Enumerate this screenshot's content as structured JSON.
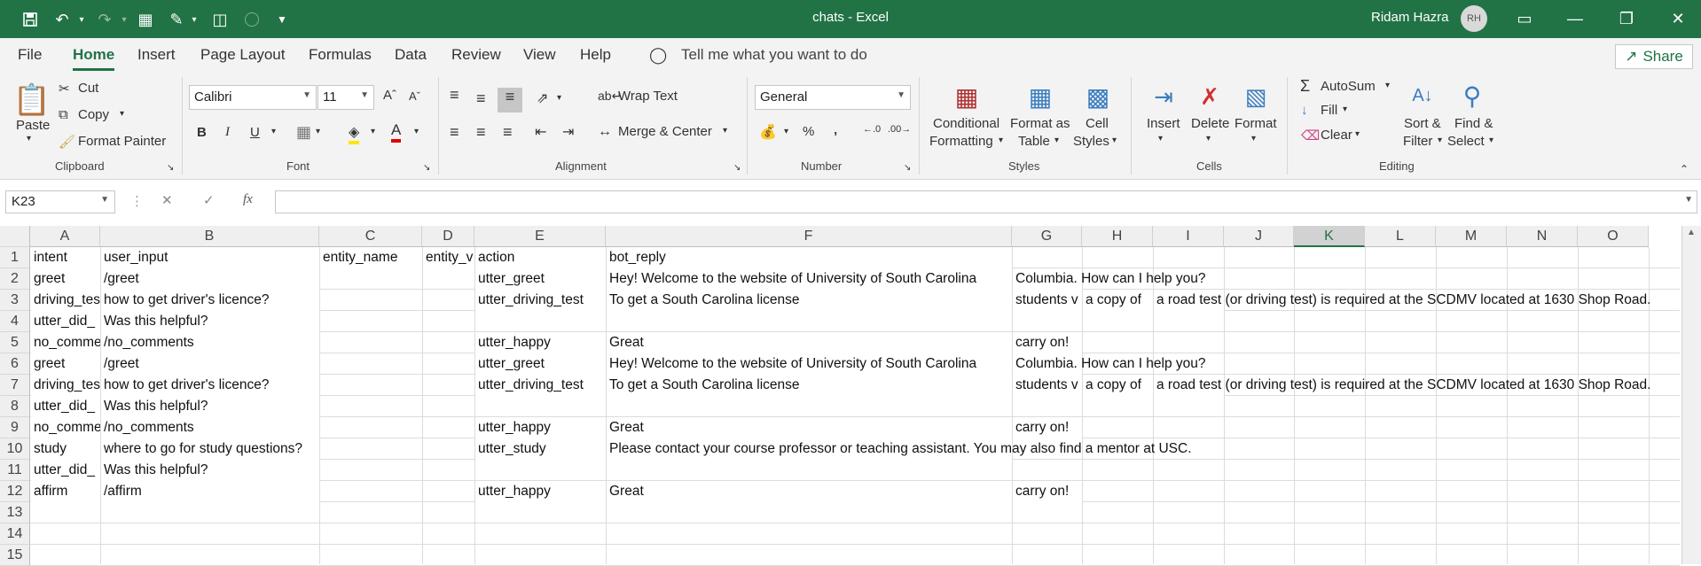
{
  "window": {
    "title": "chats  -  Excel",
    "user": "Ridam Hazra",
    "initials": "RH"
  },
  "menu": {
    "tabs": [
      "File",
      "Home",
      "Insert",
      "Page Layout",
      "Formulas",
      "Data",
      "Review",
      "View",
      "Help"
    ],
    "active": "Home",
    "tell_me": "Tell me what you want to do",
    "share": "Share"
  },
  "ribbon": {
    "clipboard": {
      "paste": "Paste",
      "cut": "Cut",
      "copy": "Copy",
      "format_painter": "Format Painter",
      "label": "Clipboard"
    },
    "font": {
      "name": "Calibri",
      "size": "11",
      "label": "Font",
      "bold": "B",
      "italic": "I",
      "underline": "U"
    },
    "alignment": {
      "wrap_text": "Wrap Text",
      "merge_center": "Merge & Center",
      "label": "Alignment"
    },
    "number": {
      "format": "General",
      "label": "Number"
    },
    "styles": {
      "conditional": "Conditional",
      "formatting": "Formatting",
      "format_as": "Format as",
      "table": "Table",
      "cell": "Cell",
      "cell_styles": "Styles",
      "label": "Styles"
    },
    "cells": {
      "insert": "Insert",
      "delete": "Delete",
      "format": "Format",
      "label": "Cells"
    },
    "editing": {
      "autosum": "AutoSum",
      "fill": "Fill",
      "clear": "Clear",
      "sort": "Sort &",
      "filter": "Filter",
      "find": "Find &",
      "select": "Select",
      "label": "Editing"
    }
  },
  "formula_bar": {
    "name_box": "K23",
    "fx": "fx",
    "value": ""
  },
  "sheet": {
    "columns": [
      "A",
      "B",
      "C",
      "D",
      "E",
      "F",
      "G",
      "H",
      "I",
      "J",
      "K",
      "L",
      "M",
      "N",
      "O"
    ],
    "selected_column": "K",
    "rows": [
      "1",
      "2",
      "3",
      "4",
      "5",
      "6",
      "7",
      "8",
      "9",
      "10",
      "11",
      "12",
      "13",
      "14",
      "15"
    ],
    "cells": [
      {
        "r": 0,
        "c": 0,
        "v": "intent"
      },
      {
        "r": 0,
        "c": 1,
        "v": "user_input"
      },
      {
        "r": 0,
        "c": 2,
        "v": "entity_name"
      },
      {
        "r": 0,
        "c": 3,
        "v": "entity_v"
      },
      {
        "r": 0,
        "c": 4,
        "v": "action"
      },
      {
        "r": 0,
        "c": 5,
        "v": "bot_reply"
      },
      {
        "r": 1,
        "c": 0,
        "v": "greet"
      },
      {
        "r": 1,
        "c": 1,
        "v": "/greet"
      },
      {
        "r": 1,
        "c": 4,
        "v": "utter_greet"
      },
      {
        "r": 1,
        "c": 5,
        "v": "Hey! Welcome to the website of University of South Carolina"
      },
      {
        "r": 1,
        "c": 6,
        "v": "Columbia. How can I help you?",
        "over": true
      },
      {
        "r": 2,
        "c": 0,
        "v": "driving_tes"
      },
      {
        "r": 2,
        "c": 1,
        "v": "how to get driver's licence?"
      },
      {
        "r": 2,
        "c": 4,
        "v": "utter_driving_test"
      },
      {
        "r": 2,
        "c": 5,
        "v": "To get a South Carolina license"
      },
      {
        "r": 2,
        "c": 6,
        "v": "students v"
      },
      {
        "r": 2,
        "c": 7,
        "v": "a copy of"
      },
      {
        "r": 2,
        "c": 8,
        "v": "a road test (or driving test) is required at the SCDMV located at 1630 Shop Road.",
        "over": true
      },
      {
        "r": 3,
        "c": 0,
        "v": "utter_did_"
      },
      {
        "r": 3,
        "c": 1,
        "v": "Was this helpful?"
      },
      {
        "r": 4,
        "c": 0,
        "v": "no_comme"
      },
      {
        "r": 4,
        "c": 1,
        "v": "/no_comments"
      },
      {
        "r": 4,
        "c": 4,
        "v": "utter_happy"
      },
      {
        "r": 4,
        "c": 5,
        "v": "Great"
      },
      {
        "r": 4,
        "c": 6,
        "v": "carry on!"
      },
      {
        "r": 5,
        "c": 0,
        "v": "greet"
      },
      {
        "r": 5,
        "c": 1,
        "v": "/greet"
      },
      {
        "r": 5,
        "c": 4,
        "v": "utter_greet"
      },
      {
        "r": 5,
        "c": 5,
        "v": "Hey! Welcome to the website of University of South Carolina"
      },
      {
        "r": 5,
        "c": 6,
        "v": "Columbia. How can I help you?",
        "over": true
      },
      {
        "r": 6,
        "c": 0,
        "v": "driving_tes"
      },
      {
        "r": 6,
        "c": 1,
        "v": "how to get driver's licence?"
      },
      {
        "r": 6,
        "c": 4,
        "v": "utter_driving_test"
      },
      {
        "r": 6,
        "c": 5,
        "v": "To get a South Carolina license"
      },
      {
        "r": 6,
        "c": 6,
        "v": "students v"
      },
      {
        "r": 6,
        "c": 7,
        "v": "a copy of"
      },
      {
        "r": 6,
        "c": 8,
        "v": "a road test (or driving test) is required at the SCDMV located at 1630 Shop Road.",
        "over": true
      },
      {
        "r": 7,
        "c": 0,
        "v": "utter_did_"
      },
      {
        "r": 7,
        "c": 1,
        "v": "Was this helpful?"
      },
      {
        "r": 8,
        "c": 0,
        "v": "no_comme"
      },
      {
        "r": 8,
        "c": 1,
        "v": "/no_comments"
      },
      {
        "r": 8,
        "c": 4,
        "v": "utter_happy"
      },
      {
        "r": 8,
        "c": 5,
        "v": "Great"
      },
      {
        "r": 8,
        "c": 6,
        "v": "carry on!"
      },
      {
        "r": 9,
        "c": 0,
        "v": "study"
      },
      {
        "r": 9,
        "c": 1,
        "v": "where to go for study questions?"
      },
      {
        "r": 9,
        "c": 4,
        "v": "utter_study"
      },
      {
        "r": 9,
        "c": 5,
        "v": "Please contact your course professor or teaching assistant. You may also find a mentor at USC.",
        "over": true
      },
      {
        "r": 10,
        "c": 0,
        "v": "utter_did_"
      },
      {
        "r": 10,
        "c": 1,
        "v": "Was this helpful?"
      },
      {
        "r": 11,
        "c": 0,
        "v": "affirm"
      },
      {
        "r": 11,
        "c": 1,
        "v": "/affirm"
      },
      {
        "r": 11,
        "c": 4,
        "v": "utter_happy"
      },
      {
        "r": 11,
        "c": 5,
        "v": "Great"
      },
      {
        "r": 11,
        "c": 6,
        "v": "carry on!"
      }
    ]
  },
  "colors": {
    "accent": "#217346"
  }
}
